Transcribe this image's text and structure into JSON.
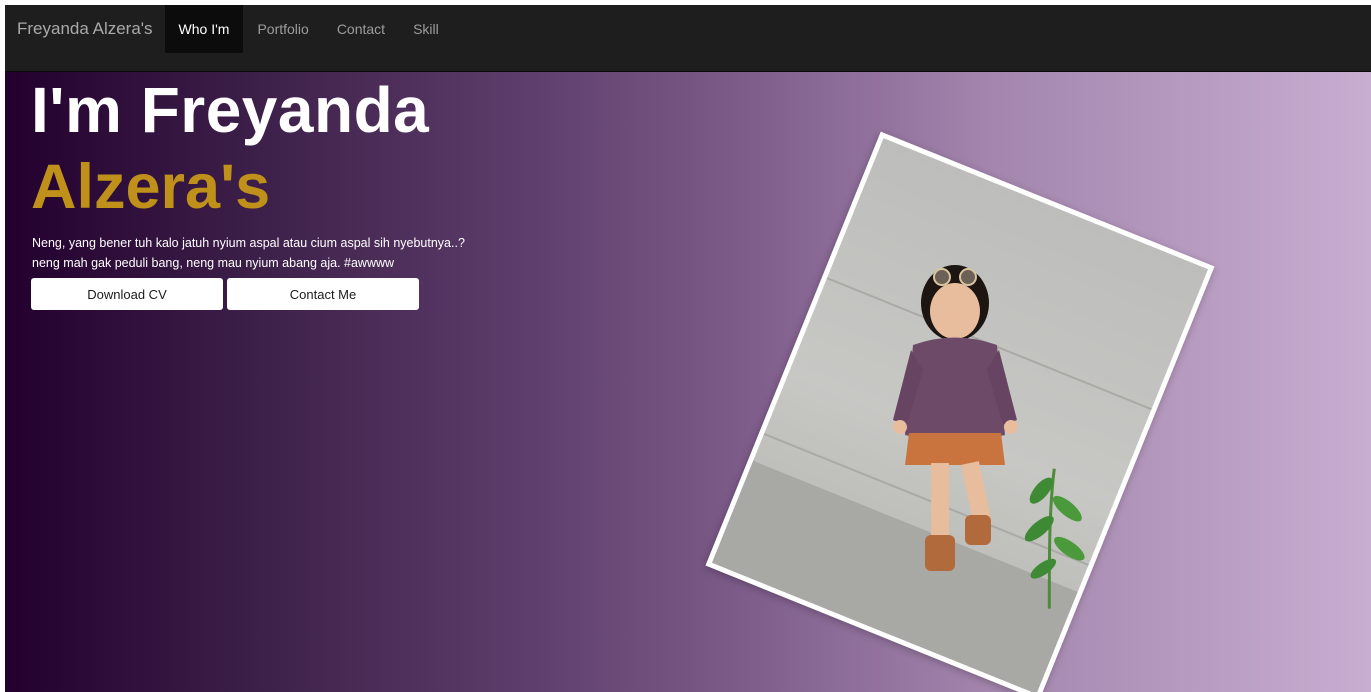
{
  "nav": {
    "brand": "Freyanda Alzera's",
    "items": [
      {
        "label": "Who I'm",
        "active": true
      },
      {
        "label": "Portfolio",
        "active": false
      },
      {
        "label": "Contact",
        "active": false
      },
      {
        "label": "Skill",
        "active": false
      }
    ]
  },
  "hero": {
    "title_line1": "I'm Freyanda",
    "title_line2": "Alzera's",
    "description_line1": "Neng, yang bener tuh kalo jatuh nyium aspal atau cium aspal sih nyebutnya..?",
    "description_line2": "neng mah gak peduli bang, neng mau nyium abang aja. #awwww",
    "buttons": {
      "download_cv": "Download CV",
      "contact_me": "Contact Me"
    },
    "photo_icon": "portrait-photo"
  },
  "colors": {
    "navbar_bg": "#1e1e1e",
    "accent_gold": "#c0911a",
    "gradient_start": "#23002e",
    "gradient_end": "#c8aed1"
  }
}
